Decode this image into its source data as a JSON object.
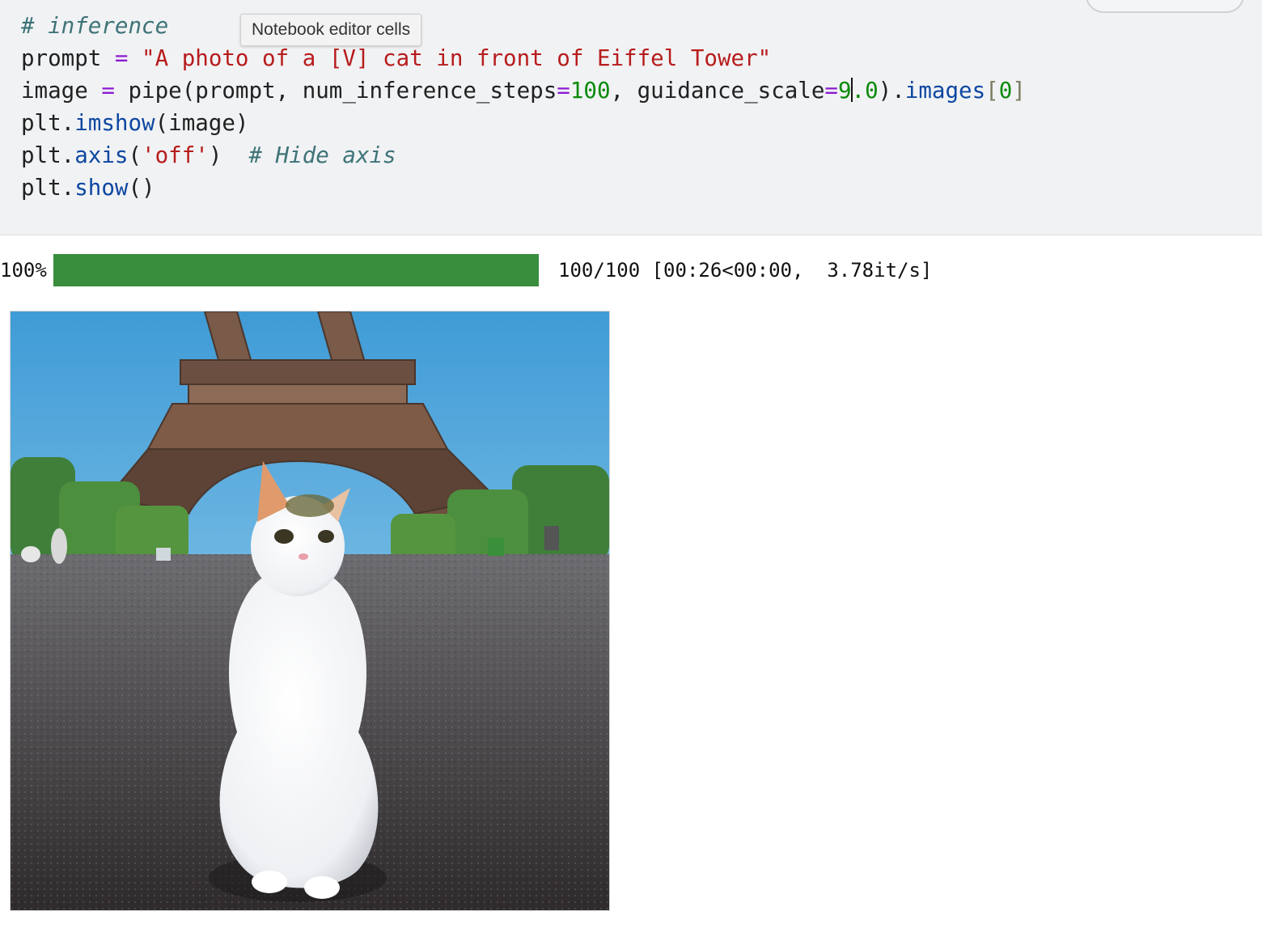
{
  "tooltip": {
    "text": "Notebook editor cells"
  },
  "code": {
    "line1": {
      "comment": "# inference"
    },
    "line2": {
      "var": "prompt ",
      "op": "=",
      "space": " ",
      "str": "\"A photo of a [V] cat in front of Eiffel Tower\""
    },
    "line3": {
      "var": "image ",
      "op": "=",
      "call": " pipe(prompt, num_inference_steps",
      "op2": "=",
      "num1": "100",
      "mid": ", guidance_scale",
      "op3": "=",
      "num2a": "9",
      "num2b": ".0",
      "close": ").",
      "attr": "images",
      "lb": "[",
      "idx": "0",
      "rb": "]"
    },
    "line4": {
      "obj": "plt.",
      "fn": "imshow",
      "args": "(image)"
    },
    "line5": {
      "obj": "plt.",
      "fn": "axis",
      "lp": "(",
      "str": "'off'",
      "rp": ")  ",
      "comment": "# Hide axis"
    },
    "line6": {
      "obj": "plt.",
      "fn": "show",
      "args": "()"
    }
  },
  "progress": {
    "percent_label": "100%",
    "fraction": 1.0,
    "stats": "100/100 [00:26<00:00,  3.78it/s]",
    "bar_color": "#388e3c"
  },
  "output": {
    "image_subject": "white cat sitting in front of the Eiffel Tower"
  }
}
